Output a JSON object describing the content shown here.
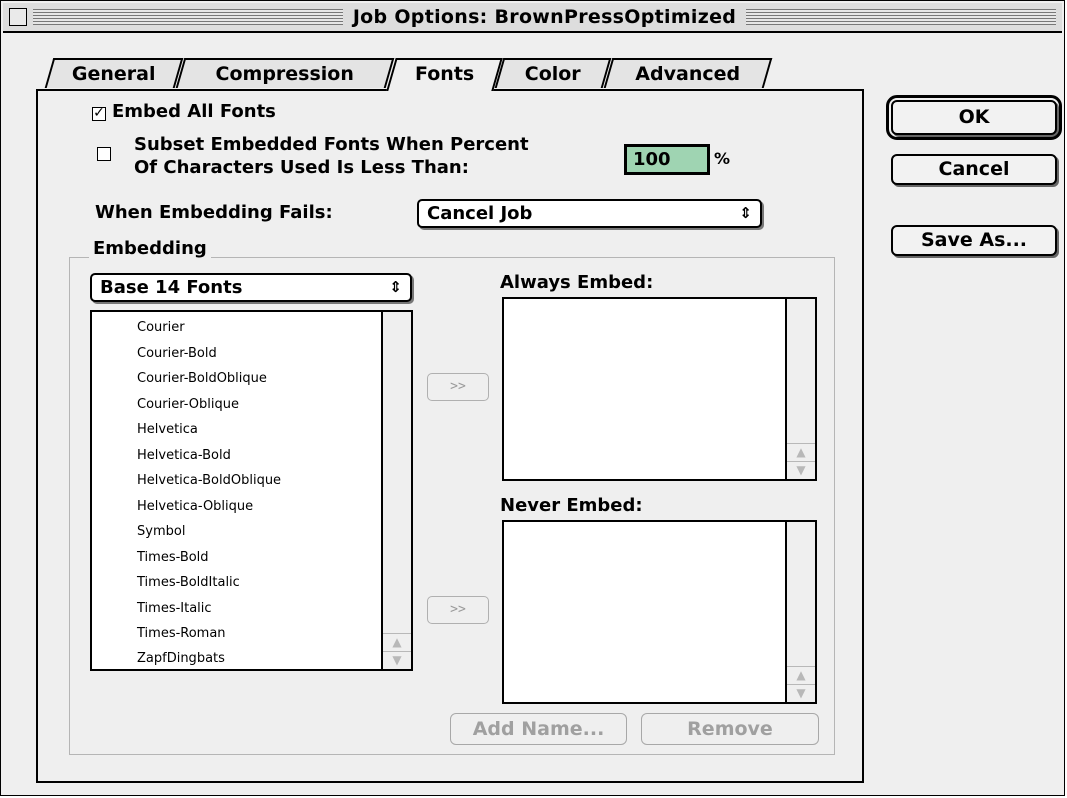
{
  "window": {
    "title": "Job Options: BrownPressOptimized"
  },
  "tabs": [
    {
      "label": "General",
      "active": false
    },
    {
      "label": "Compression",
      "active": false
    },
    {
      "label": "Fonts",
      "active": true
    },
    {
      "label": "Color",
      "active": false
    },
    {
      "label": "Advanced",
      "active": false
    }
  ],
  "fonts_panel": {
    "embed_all": {
      "label": "Embed All Fonts",
      "checked": true
    },
    "subset": {
      "label_line1": "Subset Embedded Fonts When Percent",
      "label_line2": "Of Characters Used Is Less Than:",
      "checked": false,
      "value": "100",
      "unit": "%"
    },
    "embed_fail": {
      "label": "When Embedding Fails:",
      "value": "Cancel Job"
    },
    "embedding": {
      "group_title": "Embedding",
      "source_popup": "Base 14 Fonts",
      "font_list": [
        "Courier",
        "Courier-Bold",
        "Courier-BoldOblique",
        "Courier-Oblique",
        "Helvetica",
        "Helvetica-Bold",
        "Helvetica-BoldOblique",
        "Helvetica-Oblique",
        "Symbol",
        "Times-Bold",
        "Times-BoldItalic",
        "Times-Italic",
        "Times-Roman",
        "ZapfDingbats"
      ],
      "move_label": ">>",
      "always_embed_label": "Always Embed:",
      "never_embed_label": "Never Embed:",
      "add_name_label": "Add Name...",
      "remove_label": "Remove"
    }
  },
  "buttons": {
    "ok": "OK",
    "cancel": "Cancel",
    "save_as": "Save As..."
  }
}
